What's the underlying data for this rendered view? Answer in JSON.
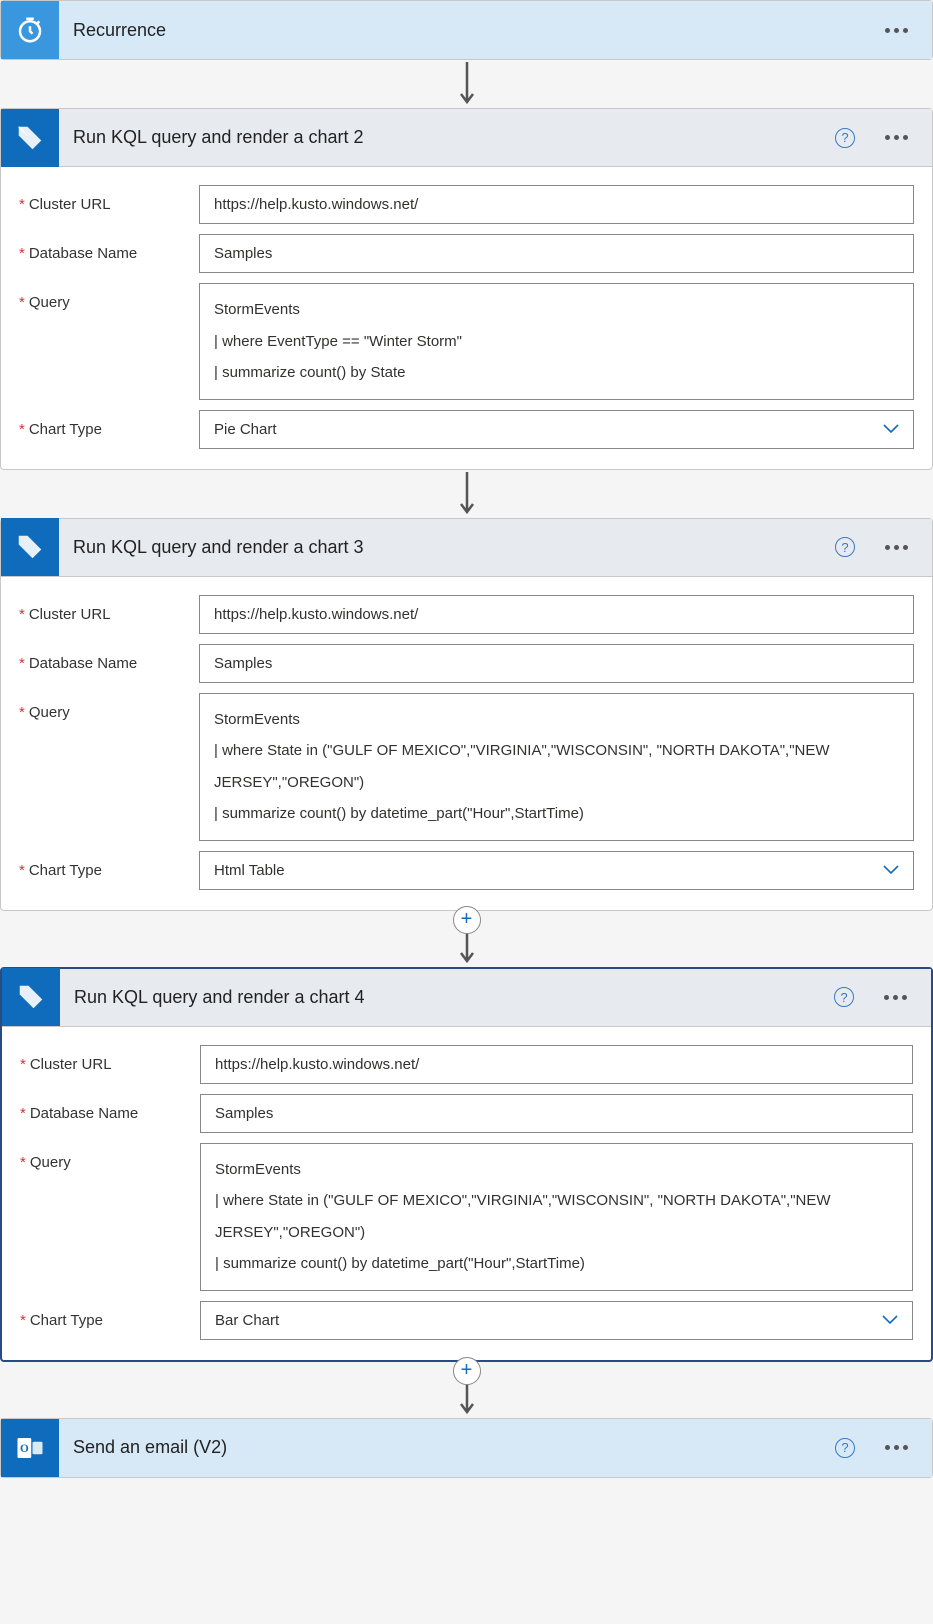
{
  "steps": {
    "recurrence": {
      "title": "Recurrence"
    },
    "kql2": {
      "title": "Run KQL query and render a chart 2",
      "labels": {
        "cluster": "Cluster URL",
        "db": "Database Name",
        "query": "Query",
        "chart": "Chart Type"
      },
      "cluster": "https://help.kusto.windows.net/",
      "db": "Samples",
      "query": "StormEvents\n| where EventType == \"Winter Storm\"\n| summarize count() by State",
      "chart": "Pie Chart"
    },
    "kql3": {
      "title": "Run KQL query and render a chart 3",
      "labels": {
        "cluster": "Cluster URL",
        "db": "Database Name",
        "query": "Query",
        "chart": "Chart Type"
      },
      "cluster": "https://help.kusto.windows.net/",
      "db": "Samples",
      "query": "StormEvents\n| where State in (\"GULF OF MEXICO\",\"VIRGINIA\",\"WISCONSIN\", \"NORTH DAKOTA\",\"NEW JERSEY\",\"OREGON\")\n| summarize count() by datetime_part(\"Hour\",StartTime)",
      "chart": "Html Table"
    },
    "kql4": {
      "title": "Run KQL query and render a chart 4",
      "labels": {
        "cluster": "Cluster URL",
        "db": "Database Name",
        "query": "Query",
        "chart": "Chart Type"
      },
      "cluster": "https://help.kusto.windows.net/",
      "db": "Samples",
      "query": "StormEvents\n| where State in (\"GULF OF MEXICO\",\"VIRGINIA\",\"WISCONSIN\", \"NORTH DAKOTA\",\"NEW JERSEY\",\"OREGON\")\n| summarize count() by datetime_part(\"Hour\",StartTime)",
      "chart": "Bar Chart"
    },
    "email": {
      "title": "Send an email (V2)"
    }
  }
}
